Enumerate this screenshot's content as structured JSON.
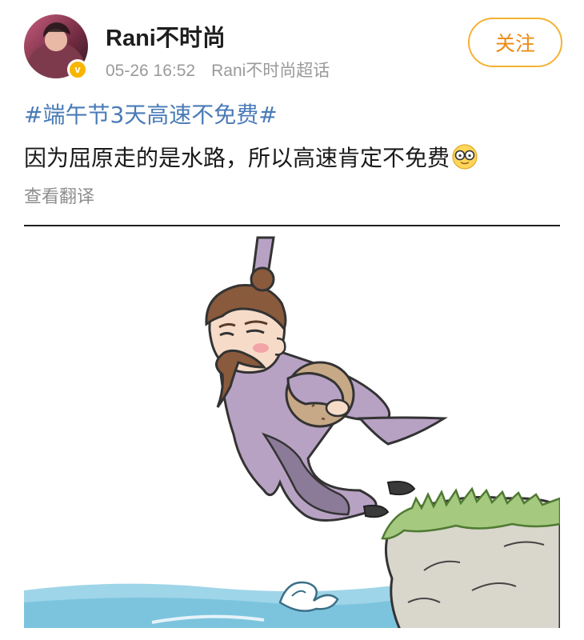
{
  "header": {
    "username": "Rani不时尚",
    "timestamp": "05-26 16:52",
    "source": "Rani不时尚超话",
    "follow_label": "关注",
    "verified_badge": "v",
    "avatar_icon": "user-avatar",
    "accent_color": "#f5b233"
  },
  "post": {
    "hashtag": "#端午节3天高速不免费#",
    "text": "因为屈原走的是水路，所以高速肯定不免费",
    "emoji_icon": "sunglasses-emoji-icon",
    "translate_label": "查看翻译",
    "image_icon": "qu-yuan-jumping-illustration",
    "hashtag_color": "#4a7bb7"
  }
}
